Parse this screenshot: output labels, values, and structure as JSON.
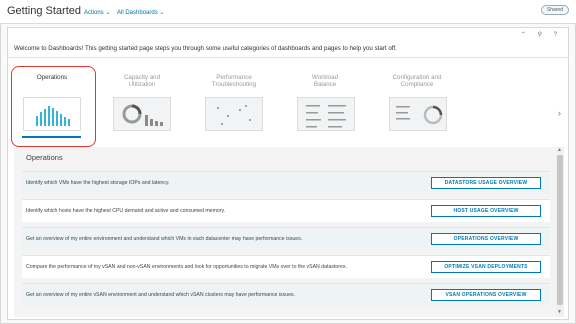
{
  "header": {
    "title": "Getting Started",
    "actions_label": "Actions ⌄",
    "dashboards_label": "All Dashboards ⌄",
    "shared_label": "Shared"
  },
  "panel": {
    "tools": "⌃ ⚲ ?",
    "welcome": "Welcome to Dashboards! This getting started page steps you through some useful categories of dashboards and pages to help you start off."
  },
  "categories": [
    {
      "line1": "Operations",
      "line2": ""
    },
    {
      "line1": "Capacity and",
      "line2": "Utilization"
    },
    {
      "line1": "Performance",
      "line2": "Troubleshooting"
    },
    {
      "line1": "Workload",
      "line2": "Balance"
    },
    {
      "line1": "Configuration and",
      "line2": "Compliance"
    }
  ],
  "section": {
    "title": "Operations",
    "rows": [
      {
        "text": "Identify which VMs have the highest storage IOPs and latency.",
        "button": "DATASTORE USAGE OVERVIEW"
      },
      {
        "text": "Identify which hosts have the highest CPU demand and active and consumed memory.",
        "button": "HOST USAGE OVERVIEW"
      },
      {
        "text": "Get an overview of my entire environment and understand which VMs in each datacenter may have performance issues.",
        "button": "OPERATIONS OVERVIEW"
      },
      {
        "text": "Compare the performance of my vSAN and non-vSAN environments and look for opportunities to migrate VMs over to the vSAN datastores.",
        "button": "OPTIMIZE VSAN DEPLOYMENTS"
      },
      {
        "text": "Get an overview of my entire vSAN environment and understand which vSAN clusters may have performance issues.",
        "button": "VSAN OPERATIONS OVERVIEW"
      }
    ]
  },
  "colors": {
    "accent": "#0079b8",
    "highlight": "#d9392f"
  },
  "icons": {
    "next": "chevron-right-icon"
  }
}
